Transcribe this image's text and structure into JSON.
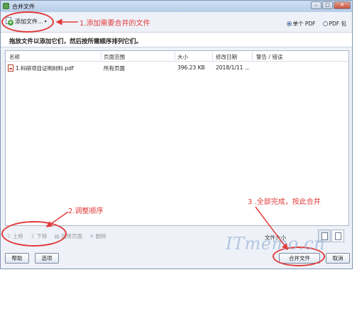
{
  "window": {
    "title": "合并文件",
    "controls": {
      "minimize": "–",
      "maximize": "□",
      "close": "✕"
    }
  },
  "toolbar": {
    "add_files_label": "添加文件...",
    "radio_single_pdf": "单个 PDF",
    "radio_pdf_package": "PDF 包",
    "selected_radio": "单个 PDF"
  },
  "instruction": "拖放文件以添加它们，然后按所需顺序排列它们。",
  "file_list": {
    "columns": [
      "名称",
      "页面范围",
      "大小",
      "修改日期",
      "警告 / 错误"
    ],
    "rows": [
      {
        "name": "1.科研项目证明材料.pdf",
        "range": "所有页面",
        "size": "396.23 KB",
        "date": "2018/1/11 ...",
        "warning": ""
      }
    ]
  },
  "bottom_tools": {
    "move_up": "上移",
    "move_down": "下移",
    "select_pages": "选择页面",
    "delete": "删除"
  },
  "file_size_label": "文件大小",
  "footer": {
    "help": "帮助",
    "options": "选项",
    "combine": "合并文件",
    "cancel": "取消"
  },
  "annotations": {
    "step1": "1.添加需要合并的文件",
    "step2": "2.调整顺序",
    "step3": "3 .全部完成，按此合并",
    "color": "#e23b3b"
  },
  "watermark": "ITmemo.cn"
}
